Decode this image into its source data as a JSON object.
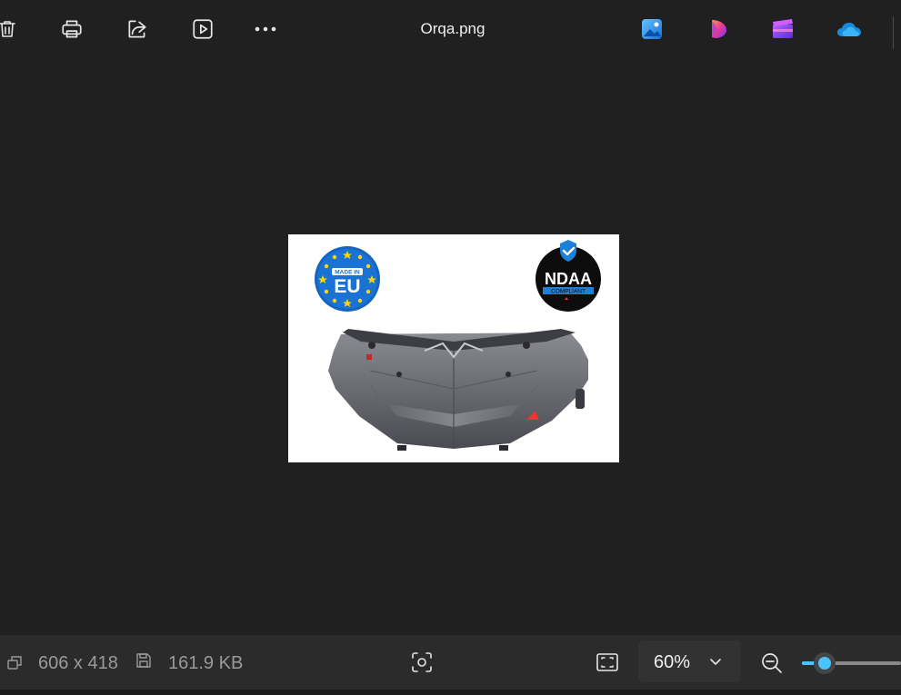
{
  "toolbar": {
    "title": "Orqa.png",
    "buttons": [
      {
        "name": "delete",
        "icon": "trash-icon"
      },
      {
        "name": "print",
        "icon": "printer-icon"
      },
      {
        "name": "share",
        "icon": "share-icon"
      },
      {
        "name": "slideshow",
        "icon": "play-icon"
      },
      {
        "name": "more",
        "icon": "more-dots-icon"
      }
    ],
    "apps": [
      {
        "name": "photos-editor",
        "icon": "photos-app-icon"
      },
      {
        "name": "copilot-designer",
        "icon": "designer-app-icon"
      },
      {
        "name": "clipchamp",
        "icon": "clipchamp-app-icon"
      },
      {
        "name": "onedrive",
        "icon": "onedrive-cloud-icon"
      }
    ]
  },
  "image": {
    "badge_left_small": "MADE IN",
    "badge_left_big": "EU",
    "badge_right_big": "NDAA",
    "badge_right_small": "COMPLIANT"
  },
  "status": {
    "dimensions": "606 x 418",
    "file_size": "161.9 KB",
    "zoom_value": "60%",
    "zoom_slider_fraction": 0.24
  },
  "colors": {
    "accent": "#4cc2ff",
    "background": "#202020",
    "statusbar": "#2b2b2b"
  }
}
